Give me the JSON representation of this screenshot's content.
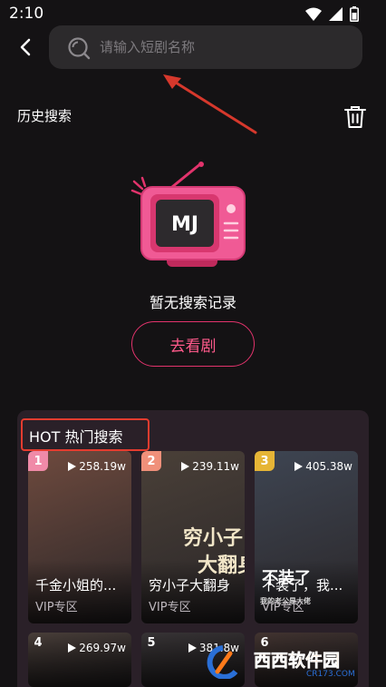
{
  "status": {
    "time": "2:10"
  },
  "search": {
    "placeholder": "请输入短剧名称"
  },
  "history": {
    "title": "历史搜索"
  },
  "empty": {
    "text": "暂无搜索记录",
    "button": "去看剧",
    "logo_text": "MJ"
  },
  "hot": {
    "title": "HOT 热门搜索",
    "items": [
      {
        "rank": "1",
        "views": "258.19w",
        "title": "千金小姐的...",
        "tag": "VIP专区",
        "rank_color": "#f08aa8",
        "poster_color": "#6e4a3e"
      },
      {
        "rank": "2",
        "views": "239.11w",
        "title": "穷小子大翻身",
        "tag": "VIP专区",
        "rank_color": "#f0907a",
        "poster_color": "#4a4038"
      },
      {
        "rank": "3",
        "views": "405.38w",
        "title": "不装了，我...",
        "tag": "VIP专区",
        "rank_color": "#e6b536",
        "poster_color": "#3e4552"
      },
      {
        "rank": "4",
        "views": "269.97w",
        "title": "",
        "tag": "",
        "rank_color": "",
        "poster_color": "#524640"
      },
      {
        "rank": "5",
        "views": "381.8w",
        "title": "",
        "tag": "",
        "rank_color": "",
        "poster_color": "#3e3a3c"
      },
      {
        "rank": "6",
        "views": "",
        "title": "",
        "tag": "",
        "rank_color": "",
        "poster_color": "#4a3a36"
      }
    ],
    "poster_text": [
      "穷小子",
      "大翻身",
      "不装了",
      "我的老公是大佬"
    ]
  },
  "watermark": {
    "site": "西西软件园",
    "url": "CR173.COM"
  },
  "colors": {
    "accent": "#e2336c",
    "highlight_box": "#e43c2f",
    "background": "#141214"
  }
}
